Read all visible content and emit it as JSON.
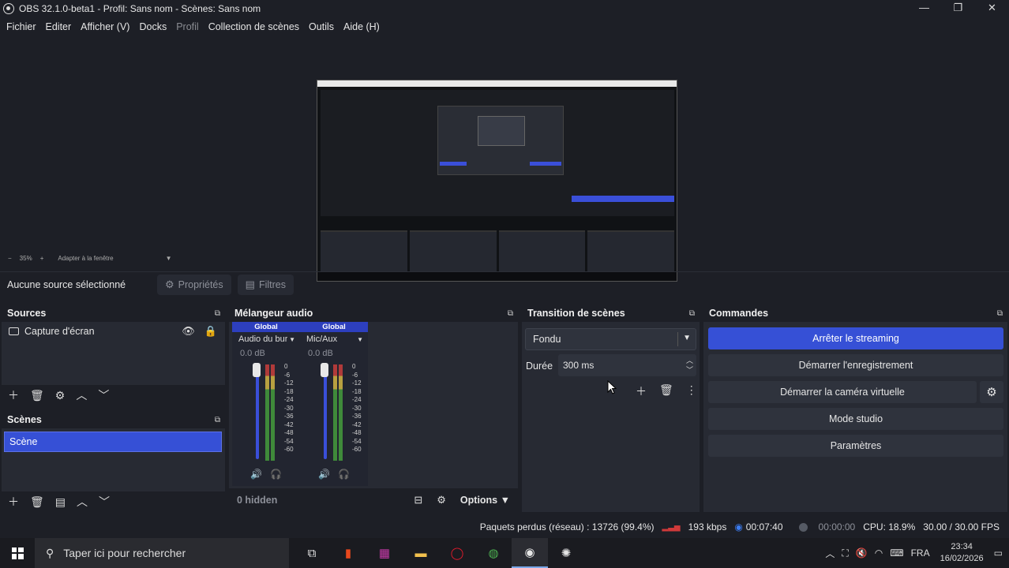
{
  "window": {
    "title": "OBS 32.1.0-beta1 - Profil: Sans nom - Scènes: Sans nom",
    "minimize": "—",
    "maximize": "❐",
    "close": "✕"
  },
  "menu": [
    "Fichier",
    "Editer",
    "Afficher (V)",
    "Docks",
    "Profil",
    "Collection de scènes",
    "Outils",
    "Aide (H)"
  ],
  "preview": {
    "zoom_minus": "−",
    "zoom_level": "35%",
    "zoom_plus": "+",
    "zoom_fit": "Adapter à la fenêtre",
    "zoom_caret": "▼"
  },
  "sourcebar": {
    "no_selection": "Aucune source sélectionné",
    "properties": "Propriétés",
    "filters": "Filtres"
  },
  "sources": {
    "title": "Sources",
    "items": [
      {
        "label": "Capture d'écran"
      }
    ]
  },
  "scenes": {
    "title": "Scènes",
    "items": [
      {
        "label": "Scène",
        "selected": true
      }
    ]
  },
  "mixer": {
    "title": "Mélangeur audio",
    "channels": [
      {
        "header": "Global",
        "name": "Audio du bureau",
        "db": "0.0 dB"
      },
      {
        "header": "Global",
        "name": "Mic/Aux",
        "db": "0.0 dB"
      }
    ],
    "scale": [
      "0",
      "-6",
      "-12",
      "-18",
      "-24",
      "-30",
      "-36",
      "-42",
      "-48",
      "-54",
      "-60"
    ],
    "hidden": "0 hidden",
    "options": "Options"
  },
  "transition": {
    "title": "Transition de scènes",
    "selected": "Fondu",
    "duration_label": "Durée",
    "duration_value": "300 ms"
  },
  "commands": {
    "title": "Commandes",
    "stop_streaming": "Arrêter le streaming",
    "start_recording": "Démarrer l'enregistrement",
    "start_virtual_cam": "Démarrer la caméra virtuelle",
    "studio_mode": "Mode studio",
    "settings": "Paramètres"
  },
  "status": {
    "dropped": "Paquets perdus (réseau) : 13726 (99.4%)",
    "bitrate": "193 kbps",
    "stream_time": "00:07:40",
    "rec_time": "00:00:00",
    "cpu": "CPU: 18.9%",
    "fps": "30.00 / 30.00 FPS"
  },
  "taskbar": {
    "search_placeholder": "Taper ici pour rechercher",
    "lang": "FRA",
    "time": "23:34",
    "date": "16/02/2026"
  },
  "colors": {
    "accent": "#3650d6",
    "background": "#1d1f26",
    "panel": "#272a33"
  }
}
